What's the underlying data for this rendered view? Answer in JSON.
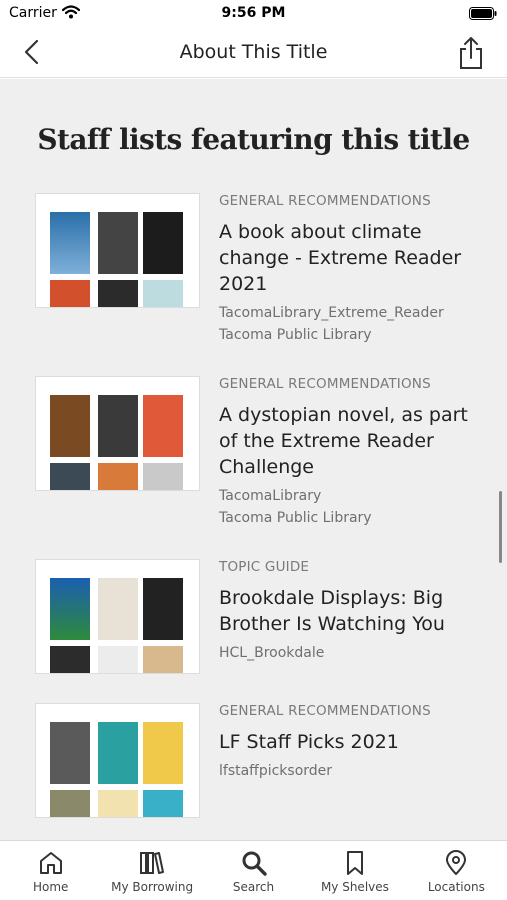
{
  "status_bar": {
    "carrier": "Carrier",
    "time": "9:56 PM"
  },
  "nav": {
    "title": "About This Title"
  },
  "section": {
    "title": "Staff lists featuring this title"
  },
  "lists": [
    {
      "type": "GENERAL RECOMMENDATIONS",
      "title": "A book about climate change - Extreme Reader 2021",
      "owner": "TacomaLibrary_Extreme_Reader",
      "library": "Tacoma Public Library"
    },
    {
      "type": "GENERAL RECOMMENDATIONS",
      "title": "A dystopian novel, as part of the Extreme Reader Challenge",
      "owner": "TacomaLibrary",
      "library": "Tacoma Public Library"
    },
    {
      "type": "TOPIC GUIDE",
      "title": "Brookdale Displays: Big Brother Is Watching You",
      "owner": "HCL_Brookdale"
    },
    {
      "type": "GENERAL RECOMMENDATIONS",
      "title": "LF Staff Picks 2021",
      "owner": "lfstaffpicksorder"
    }
  ],
  "tabs": [
    {
      "label": "Home",
      "icon": "home-icon"
    },
    {
      "label": "My Borrowing",
      "icon": "books-icon"
    },
    {
      "label": "Search",
      "icon": "search-icon"
    },
    {
      "label": "My Shelves",
      "icon": "bookmark-icon"
    },
    {
      "label": "Locations",
      "icon": "location-pin-icon"
    }
  ],
  "colors": {
    "background": "#efefef",
    "text": "#222222",
    "muted": "#7a7a7a"
  }
}
